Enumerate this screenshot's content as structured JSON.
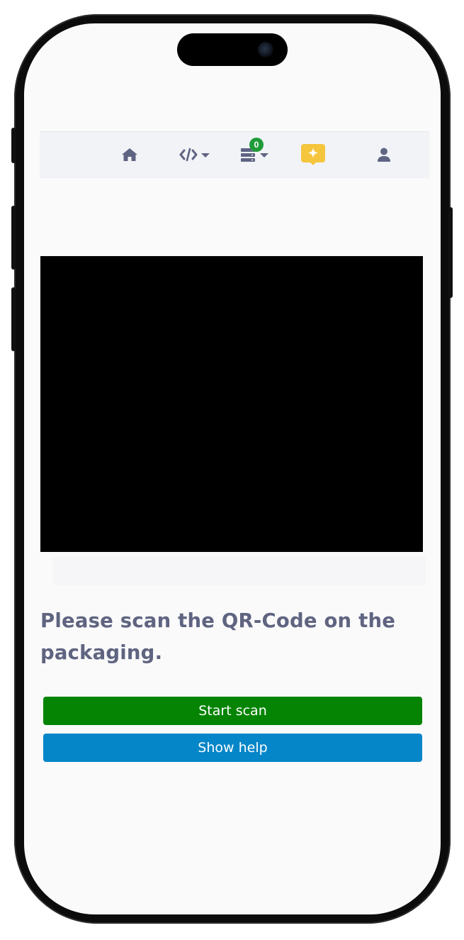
{
  "navbar": {
    "items": [
      {
        "name": "home",
        "icon": "home-icon"
      },
      {
        "name": "code",
        "icon": "code-icon",
        "has_dropdown": true
      },
      {
        "name": "devices",
        "icon": "server-icon",
        "has_dropdown": true,
        "badge": "0"
      },
      {
        "name": "highlights",
        "icon": "sparkle-chat-icon"
      },
      {
        "name": "account",
        "icon": "user-icon"
      }
    ]
  },
  "scanner": {
    "instruction": "Please scan the QR-Code on the packaging."
  },
  "actions": {
    "start_label": "Start scan",
    "help_label": "Show help"
  },
  "colors": {
    "start_button": "#048402",
    "help_button": "#0586c8",
    "badge": "#1f9b3a",
    "highlight_icon": "#f5c53d",
    "nav_icon": "#5f6483",
    "text": "#5f6480"
  }
}
